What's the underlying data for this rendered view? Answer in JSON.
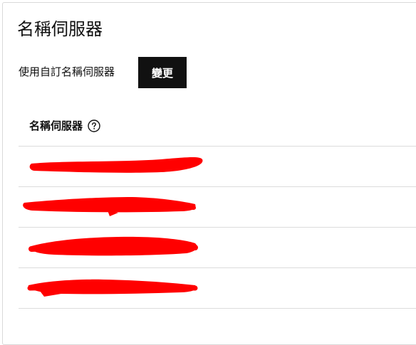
{
  "page": {
    "title": "名稱伺服器"
  },
  "mode": {
    "label": "使用自訂名稱伺服器",
    "change_button_label": "變更"
  },
  "nameservers": {
    "header_label": "名稱伺服器",
    "help_icon": "question-circle-icon",
    "items": [
      {
        "value": ""
      },
      {
        "value": ""
      },
      {
        "value": ""
      },
      {
        "value": ""
      }
    ],
    "redaction_color": "#ff0000"
  },
  "colors": {
    "button_bg": "#111111",
    "button_text": "#ffffff",
    "divider": "#dcdcdc",
    "border": "#d9d9d9"
  }
}
